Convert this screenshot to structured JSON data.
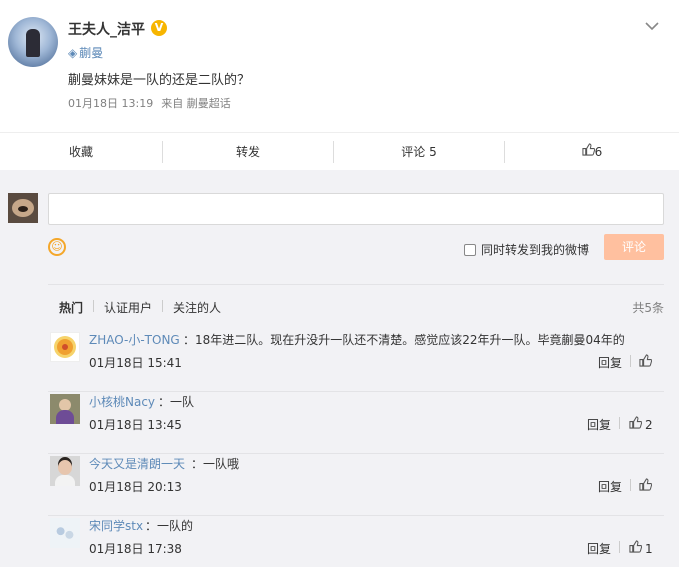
{
  "post": {
    "author": "王夫人_洁平",
    "verified_badge": "V",
    "topic_icon": "supertopic-icon",
    "topic": "蒯曼",
    "content": "蒯曼妹妹是一队的还是二队的？",
    "time": "01月18日 13:19",
    "source": "来自 蒯曼超话",
    "menu_icon": "chevron-down-icon"
  },
  "actions": {
    "favorite": "收藏",
    "repost": "转发",
    "comment": "评论 5",
    "like_icon": "thumb-up-icon",
    "like_count": "6"
  },
  "composer": {
    "placeholder": "",
    "emoji_icon": "smiley-icon",
    "forward_label": "同时转发到我的微博",
    "submit": "评论"
  },
  "comment_tabs": {
    "tabs": [
      "热门",
      "认证用户",
      "关注的人"
    ],
    "total": "共5条"
  },
  "comments": [
    {
      "user": "ZHAO-小-TONG",
      "text": "：18年进二队。现在升没升一队还不清楚。感觉应该22年升一队。毕竟蒯曼04年的",
      "time": "01月18日 15:41",
      "reply": "回复",
      "likes": ""
    },
    {
      "user": "小核桃Nacy",
      "text": "：一队",
      "time": "01月18日 13:45",
      "reply": "回复",
      "likes": "2"
    },
    {
      "user": "今天又是清朗一天",
      "text": "：一队哦",
      "time": "01月18日 20:13",
      "reply": "回复",
      "likes": ""
    },
    {
      "user": "宋同学stx",
      "text": "：一队的",
      "time": "01月18日 17:38",
      "reply": "回复",
      "likes": "1"
    }
  ],
  "colors": {
    "link_blue": "#5e8ab8",
    "submit_disabled": "#ffc09f",
    "verified": "#f7b500",
    "comment_bg": "#f2f2f5"
  }
}
